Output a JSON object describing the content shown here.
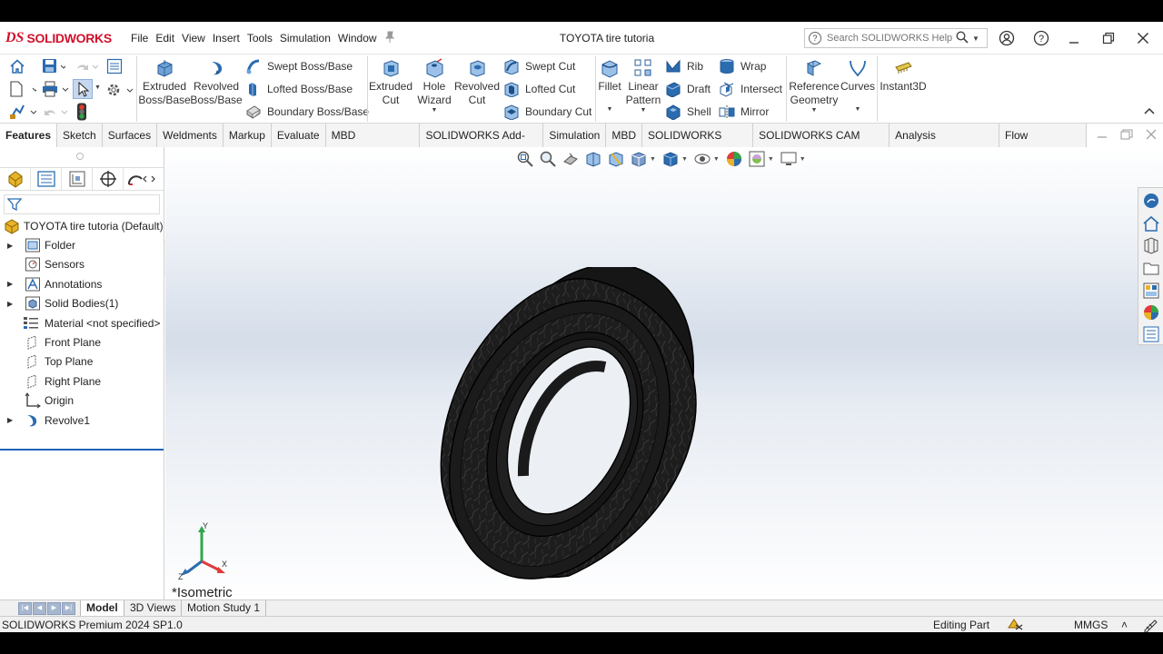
{
  "app": {
    "brand_ds": "DS",
    "brand_name": "SOLIDWORKS",
    "document_title": "TOYOTA tire tutoria"
  },
  "menu": [
    "File",
    "Edit",
    "View",
    "Insert",
    "Tools",
    "Simulation",
    "Window"
  ],
  "search": {
    "placeholder": "Search SOLIDWORKS Help"
  },
  "command_manager": {
    "features": {
      "extruded_boss": "Extruded\nBoss/Base",
      "revolved_boss": "Revolved\nBoss/Base",
      "swept_boss": "Swept Boss/Base",
      "lofted_boss": "Lofted Boss/Base",
      "boundary_boss": "Boundary Boss/Base",
      "extruded_cut": "Extruded\nCut",
      "hole_wizard": "Hole\nWizard",
      "revolved_cut": "Revolved\nCut",
      "swept_cut": "Swept Cut",
      "lofted_cut": "Lofted Cut",
      "boundary_cut": "Boundary Cut",
      "fillet": "Fillet",
      "linear_pattern": "Linear\nPattern",
      "rib": "Rib",
      "draft": "Draft",
      "shell": "Shell",
      "wrap": "Wrap",
      "intersect": "Intersect",
      "mirror": "Mirror",
      "reference_geometry": "Reference\nGeometry",
      "curves": "Curves",
      "instant3d": "Instant3D"
    }
  },
  "tabs": [
    {
      "label": "Features",
      "active": true
    },
    {
      "label": "Sketch"
    },
    {
      "label": "Surfaces"
    },
    {
      "label": "Weldments"
    },
    {
      "label": "Markup"
    },
    {
      "label": "Evaluate"
    },
    {
      "label": "MBD Dimensions"
    },
    {
      "label": "SOLIDWORKS Add-Ins"
    },
    {
      "label": "Simulation"
    },
    {
      "label": "MBD"
    },
    {
      "label": "SOLIDWORKS CAM"
    },
    {
      "label": "SOLIDWORKS CAM TBM"
    },
    {
      "label": "Analysis Preparation"
    },
    {
      "label": "Flow Simulation"
    }
  ],
  "feature_tree": {
    "root": "TOYOTA tire tutoria  (Default)",
    "items": [
      {
        "label": "Folder",
        "expandable": true,
        "icon": "folder-icon"
      },
      {
        "label": "Sensors",
        "expandable": false,
        "icon": "sensors-icon"
      },
      {
        "label": "Annotations",
        "expandable": true,
        "icon": "annotations-icon"
      },
      {
        "label": "Solid Bodies(1)",
        "expandable": true,
        "icon": "solid-bodies-icon"
      },
      {
        "label": "Material <not specified>",
        "expandable": false,
        "icon": "material-icon"
      },
      {
        "label": "Front Plane",
        "expandable": false,
        "icon": "plane-icon"
      },
      {
        "label": "Top Plane",
        "expandable": false,
        "icon": "plane-icon"
      },
      {
        "label": "Right Plane",
        "expandable": false,
        "icon": "plane-icon"
      },
      {
        "label": "Origin",
        "expandable": false,
        "icon": "origin-icon"
      },
      {
        "label": "Revolve1",
        "expandable": true,
        "icon": "revolve-icon"
      }
    ]
  },
  "viewport": {
    "view_name": "*Isometric",
    "triad": {
      "x": "X",
      "y": "Y",
      "z": "Z"
    },
    "model_color": "#1b1b1b",
    "background_top": "#ffffff",
    "background_mid": "#d5dde9"
  },
  "bottom_tabs": [
    "Model",
    "3D Views",
    "Motion Study 1"
  ],
  "status": {
    "version": "SOLIDWORKS Premium 2024 SP1.0",
    "mode": "Editing Part",
    "units": "MMGS",
    "units_arrow": "˄"
  },
  "colors": {
    "accent": "#1f63b5",
    "brand": "#d0112b",
    "icon_blue": "#2b6cb0"
  }
}
